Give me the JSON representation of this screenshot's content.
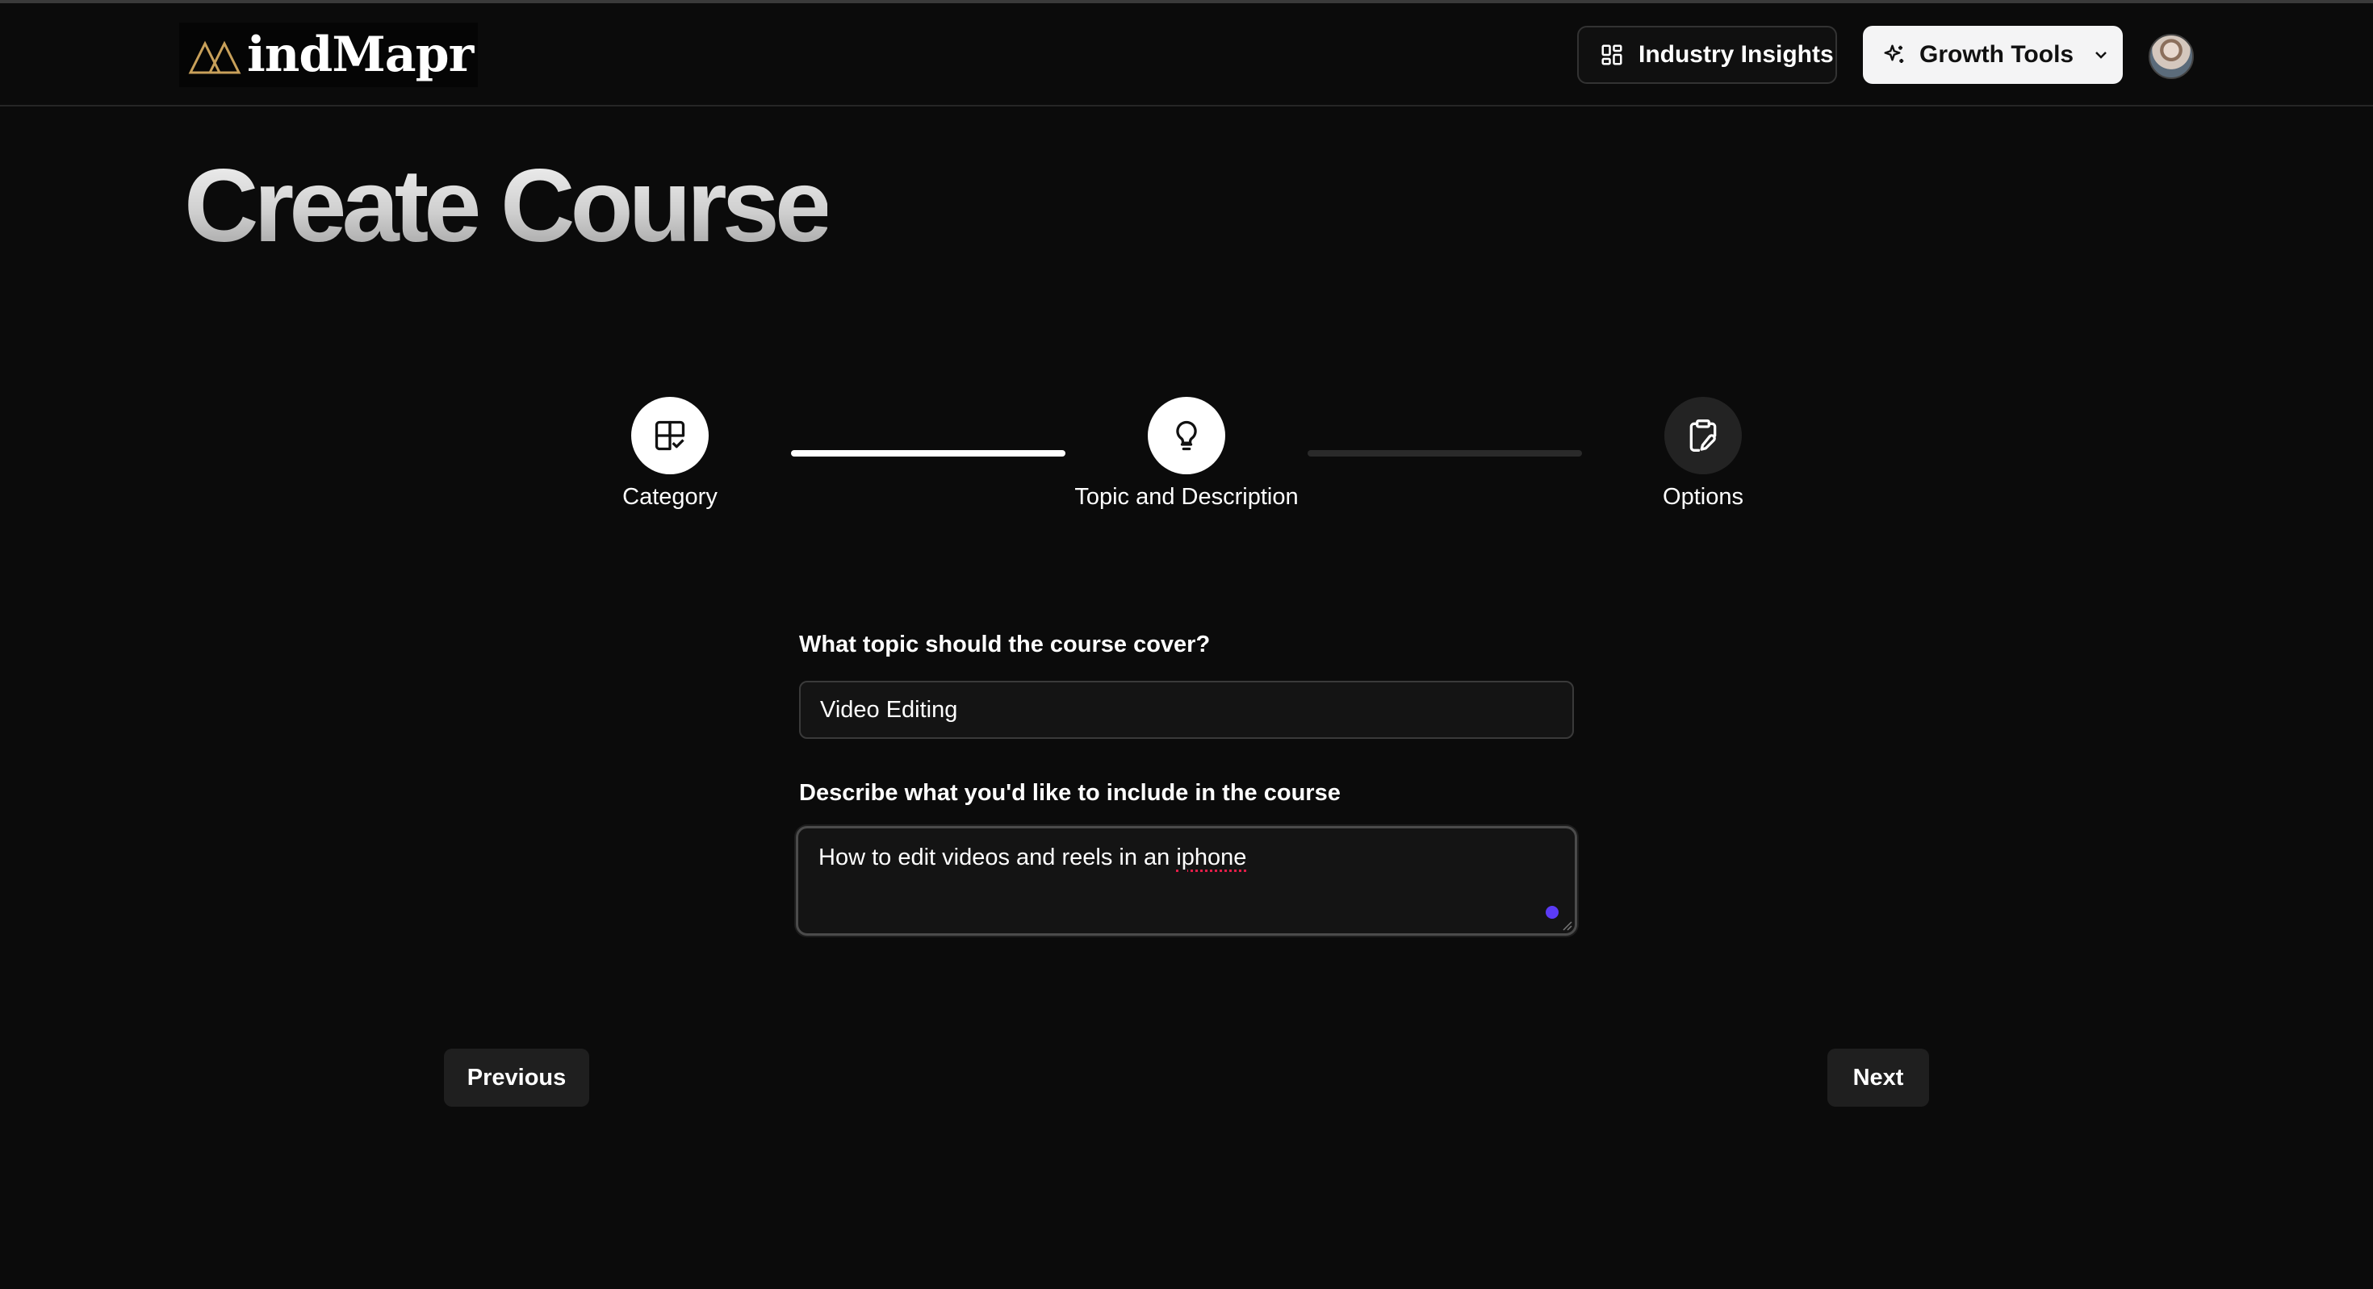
{
  "header": {
    "brand": "indMapr",
    "insights_label": "Industry Insights",
    "growth_label": "Growth Tools"
  },
  "page": {
    "title": "Create Course"
  },
  "stepper": {
    "steps": [
      {
        "label": "Category",
        "icon": "grid-check-icon",
        "state": "active"
      },
      {
        "label": "Topic and Description",
        "icon": "lightbulb-icon",
        "state": "active"
      },
      {
        "label": "Options",
        "icon": "clipboard-edit-icon",
        "state": "inactive"
      }
    ],
    "connector_colors": {
      "complete": "#ffffff",
      "incomplete": "#2a2a2a"
    }
  },
  "form": {
    "topic_label": "What topic should the course cover?",
    "topic_value": "Video Editing",
    "description_label": "Describe what you'd like to include in the course",
    "description_value_prefix": "How to edit videos and reels in an ",
    "description_value_flagged": "iphone"
  },
  "nav": {
    "previous_label": "Previous",
    "next_label": "Next"
  },
  "colors": {
    "background": "#0b0b0b",
    "accent_dot": "#5b3bf5",
    "primary_button": "#f4f4f5"
  }
}
